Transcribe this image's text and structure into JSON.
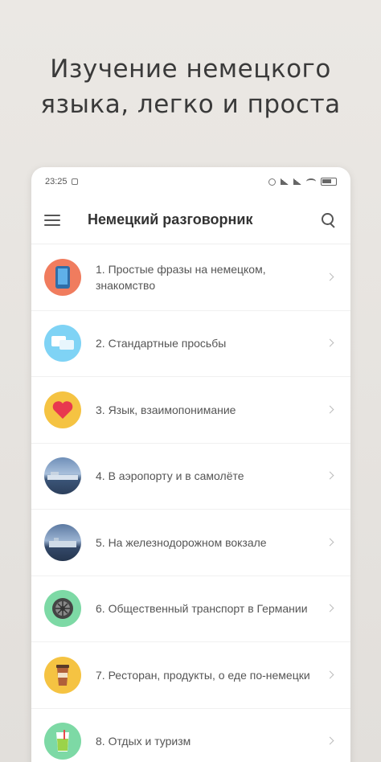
{
  "promo": {
    "line1": "Изучение немецкого",
    "line2": "языка, легко и проста"
  },
  "statusbar": {
    "time": "23:25"
  },
  "appbar": {
    "title": "Немецкий разговорник",
    "menu_icon": "hamburger-menu-icon",
    "search_icon": "search-icon"
  },
  "items": [
    {
      "label": "1. Простые фразы на немецком, знакомство",
      "icon": "phone-icon",
      "color": "#f07c5e"
    },
    {
      "label": "2. Стандартные просьбы",
      "icon": "chat-bubbles-icon",
      "color": "#7fd3f5"
    },
    {
      "label": "3. Язык, взаимопонимание",
      "icon": "heart-icon",
      "color": "#f5c342"
    },
    {
      "label": "4. В аэропорту и в самолёте",
      "icon": "airport-photo-icon",
      "color": "#4a6a94"
    },
    {
      "label": "5. На железнодорожном вокзале",
      "icon": "train-station-photo-icon",
      "color": "#4a6a94"
    },
    {
      "label": "6. Общественный транспорт в Германии",
      "icon": "wheel-icon",
      "color": "#7dd9a5"
    },
    {
      "label": "7. Ресторан, продукты, о еде по-немецки",
      "icon": "coffee-cup-icon",
      "color": "#f5c342"
    },
    {
      "label": "8. Отдых и туризм",
      "icon": "drink-glass-icon",
      "color": "#7dd9a5"
    }
  ]
}
